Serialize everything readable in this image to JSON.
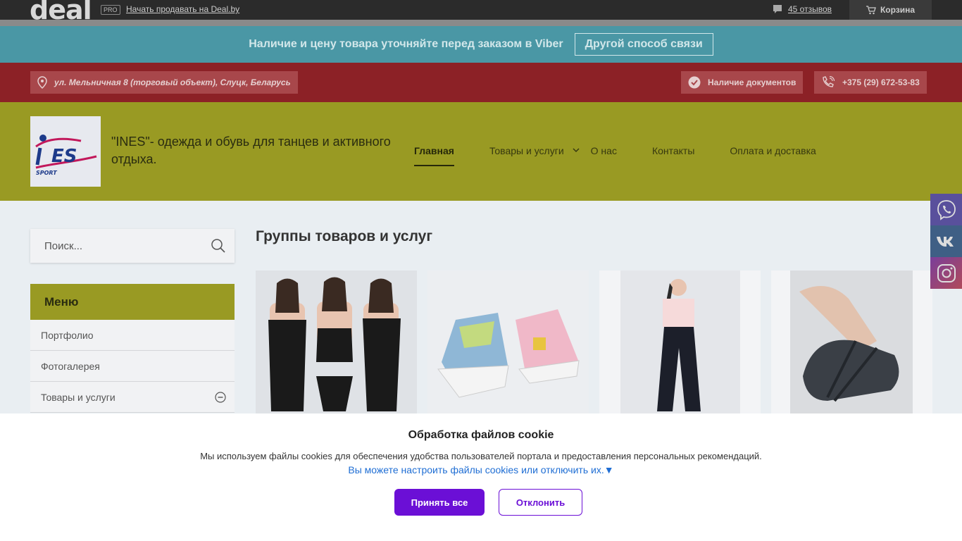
{
  "topbar": {
    "logo": "deal",
    "pro_badge": "PRO",
    "sell_link": "Начать продавать на Deal.by",
    "reviews_link": "45 отзывов",
    "cart_label": "Корзина"
  },
  "viber_banner": {
    "message": "Наличие и цену товара уточняйте перед заказом в Viber",
    "button": "Другой способ связи"
  },
  "info_bar": {
    "address": "ул. Мельничная 8 (торговый объект), Слуцк, Беларусь",
    "documents": "Наличие документов",
    "phone": "+375 (29) 672-53-83"
  },
  "header": {
    "brand_title": "\"INES\"- одежда и обувь для танцев и активного отдыха.",
    "logo_text": "ES",
    "logo_sub": "SPORT",
    "nav": [
      {
        "label": "Главная",
        "active": true
      },
      {
        "label": "Товары и услуги",
        "has_dropdown": true
      },
      {
        "label": "О нас"
      },
      {
        "label": "Контакты"
      },
      {
        "label": "Оплата и доставка"
      }
    ]
  },
  "search": {
    "placeholder": "Поиск..."
  },
  "sidebar_menu": {
    "title": "Меню",
    "items": [
      "Портфолио",
      "Фотогалерея",
      "Товары и услуги"
    ]
  },
  "main": {
    "section_title": "Группы товаров и услуг"
  },
  "social": [
    "viber-icon",
    "vk-icon",
    "instagram-icon"
  ],
  "cookie": {
    "title": "Обработка файлов cookie",
    "description": "Мы используем файлы cookies для обеспечения удобства пользователей портала и предоставления персональных рекомендаций.",
    "settings_link": "Вы можете настроить файлы cookies или отключить их.▼",
    "accept": "Принять все",
    "decline": "Отклонить"
  },
  "colors": {
    "accent_yellow": "#999a23",
    "red_bar": "#8c2126",
    "viber_teal": "#4a97a5",
    "accept_purple": "#6b0fd6"
  }
}
